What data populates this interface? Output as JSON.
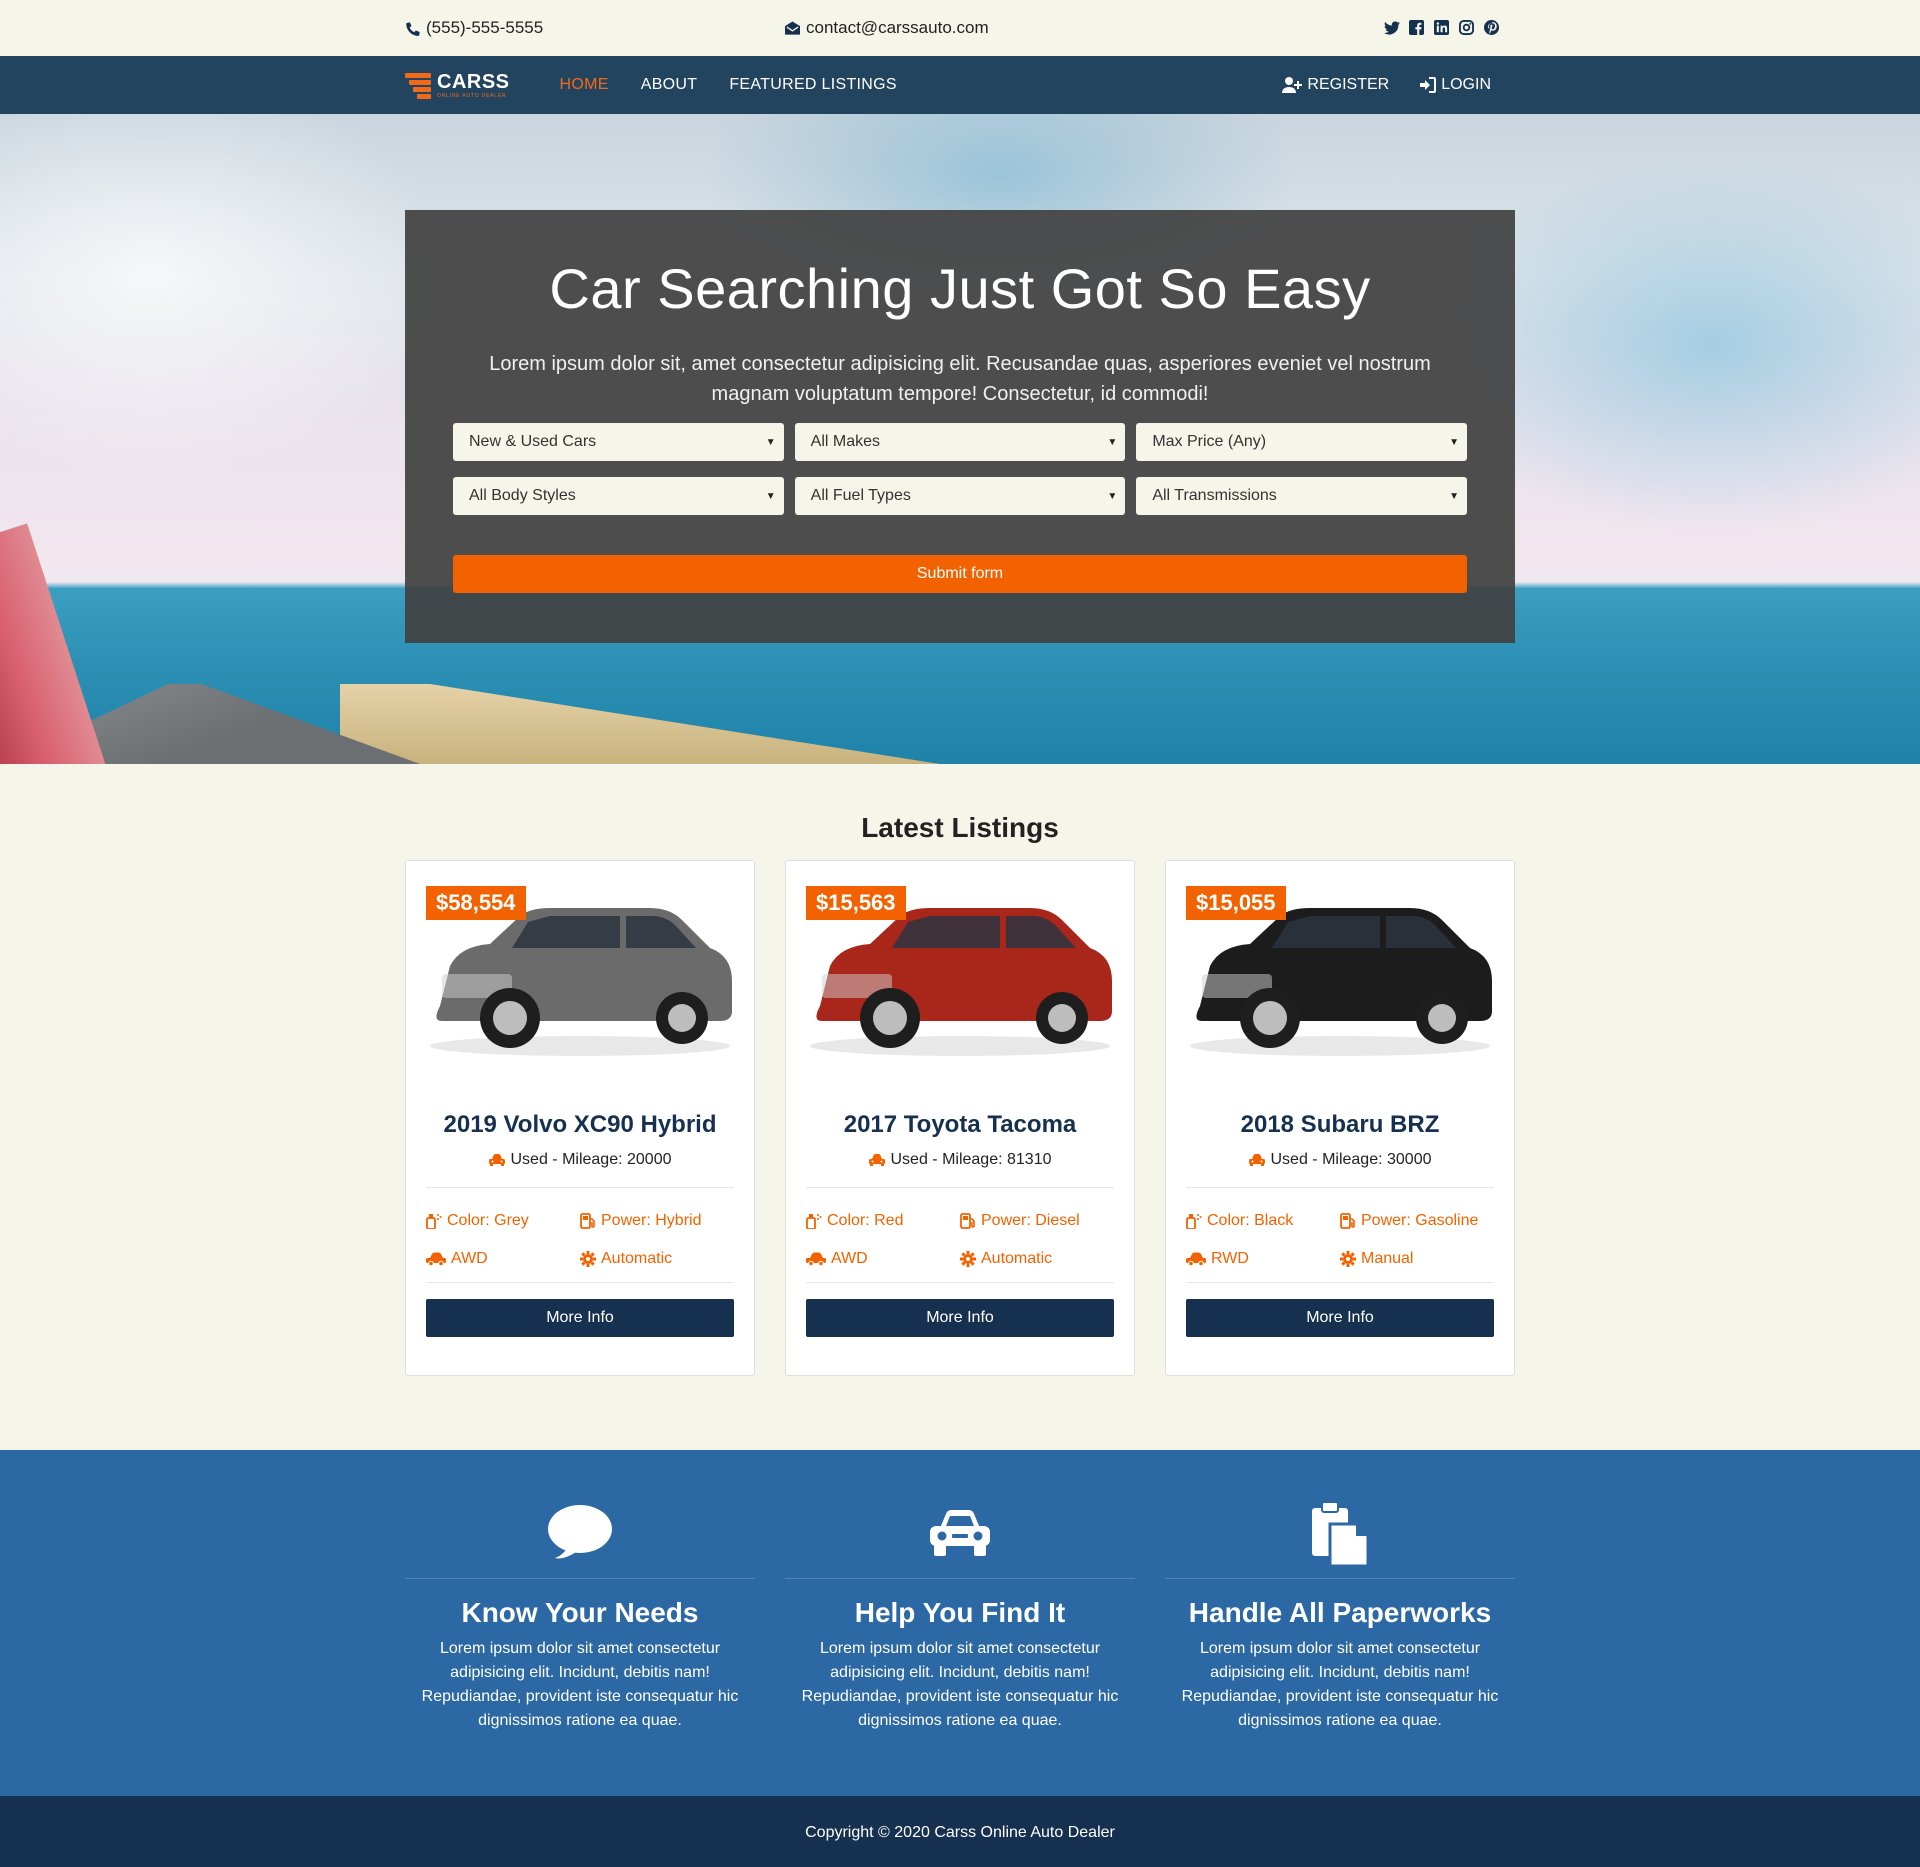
{
  "topbar": {
    "phone": "(555)-555-5555",
    "email": "contact@carssauto.com",
    "social": [
      "twitter-icon",
      "facebook-icon",
      "linkedin-icon",
      "instagram-icon",
      "pinterest-icon"
    ]
  },
  "nav": {
    "logo_name": "CARSS",
    "logo_sub": "ONLINE AUTO DEALER",
    "links": [
      "HOME",
      "ABOUT",
      "FEATURED LISTINGS"
    ],
    "register": "REGISTER",
    "login": "LOGIN"
  },
  "hero": {
    "title": "Car Searching Just Got So Easy",
    "subtitle": "Lorem ipsum dolor sit, amet consectetur adipisicing elit. Recusandae quas, asperiores eveniet vel nostrum magnam voluptatum tempore! Consectetur, id commodi!",
    "selects": [
      "New & Used Cars",
      "All Makes",
      "Max Price (Any)",
      "All Body Styles",
      "All Fuel Types",
      "All Transmissions"
    ],
    "submit": "Submit form"
  },
  "listings": {
    "heading": "Latest Listings",
    "cards": [
      {
        "price": "$58,554",
        "title": "2019 Volvo XC90 Hybrid",
        "sub": "Used - Mileage: 20000",
        "color": "Color: Grey",
        "power": "Power: Hybrid",
        "drive": "AWD",
        "trans": "Automatic",
        "button": "More Info",
        "car_color": "#6b6b6b"
      },
      {
        "price": "$15,563",
        "title": "2017 Toyota Tacoma",
        "sub": "Used - Mileage: 81310",
        "color": "Color: Red",
        "power": "Power: Diesel",
        "drive": "AWD",
        "trans": "Automatic",
        "button": "More Info",
        "car_color": "#a8261a"
      },
      {
        "price": "$15,055",
        "title": "2018 Subaru BRZ",
        "sub": "Used - Mileage: 30000",
        "color": "Color: Black",
        "power": "Power: Gasoline",
        "drive": "RWD",
        "trans": "Manual",
        "button": "More Info",
        "car_color": "#1c1c1c"
      }
    ]
  },
  "features": [
    {
      "icon": "chat-bubble-icon",
      "title": "Know Your Needs",
      "text": "Lorem ipsum dolor sit amet consectetur adipisicing elit. Incidunt, debitis nam! Repudiandae, provident iste consequatur hic dignissimos ratione ea quae."
    },
    {
      "icon": "car-icon",
      "title": "Help You Find It",
      "text": "Lorem ipsum dolor sit amet consectetur adipisicing elit. Incidunt, debitis nam! Repudiandae, provident iste consequatur hic dignissimos ratione ea quae."
    },
    {
      "icon": "paste-icon",
      "title": "Handle All Paperworks",
      "text": "Lorem ipsum dolor sit amet consectetur adipisicing elit. Incidunt, debitis nam! Repudiandae, provident iste consequatur hic dignissimos ratione ea quae."
    }
  ],
  "footer": {
    "copyright": "Copyright © 2020 Carss Online Auto Dealer"
  },
  "colors": {
    "accent": "#f26200",
    "navy": "#16304f",
    "nav_bg": "#22445f",
    "feature_bg": "#2c68a3",
    "page_bg": "#f6f5e9"
  }
}
